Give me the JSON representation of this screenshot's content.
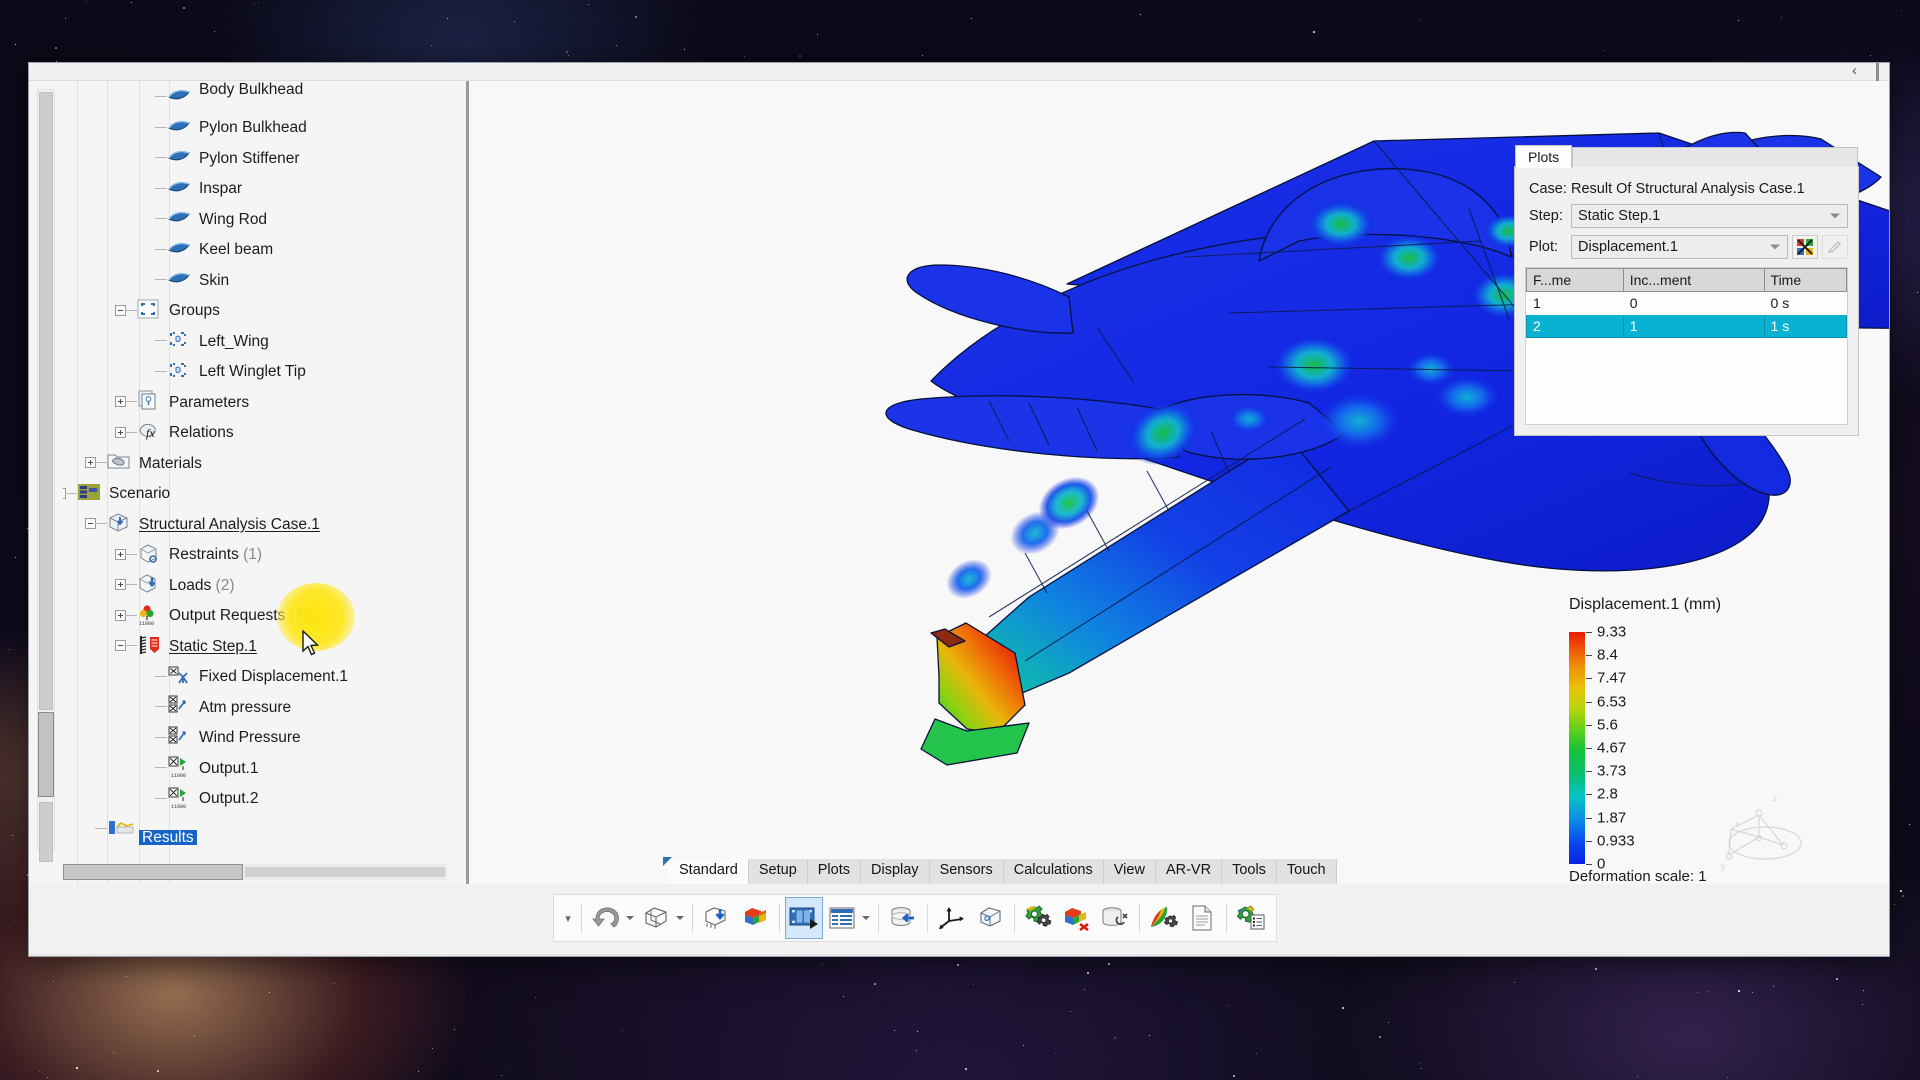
{
  "window": {
    "collapse_icon": "chevron-left-icon"
  },
  "tree": {
    "items": [
      {
        "label": "Body Bulkhead",
        "icon": "surface-icon",
        "depth": 4,
        "expander": "none",
        "partial_top": true
      },
      {
        "label": "Pylon Bulkhead",
        "icon": "surface-icon",
        "depth": 4,
        "expander": "none"
      },
      {
        "label": "Pylon Stiffener",
        "icon": "surface-icon",
        "depth": 4,
        "expander": "none"
      },
      {
        "label": "Inspar",
        "icon": "surface-icon",
        "depth": 4,
        "expander": "none"
      },
      {
        "label": "Wing Rod",
        "icon": "surface-icon",
        "depth": 4,
        "expander": "none"
      },
      {
        "label": "Keel beam",
        "icon": "surface-icon",
        "depth": 4,
        "expander": "none"
      },
      {
        "label": "Skin",
        "icon": "surface-icon",
        "depth": 4,
        "expander": "none",
        "last_child": true
      },
      {
        "label": "Groups",
        "icon": "groups-icon",
        "depth": 3,
        "expander": "minus"
      },
      {
        "label": "Left_Wing",
        "icon": "group-selection-icon",
        "depth": 4,
        "expander": "none"
      },
      {
        "label": "Left Winglet Tip",
        "icon": "group-selection-icon",
        "depth": 4,
        "expander": "none",
        "last_child": true
      },
      {
        "label": "Parameters",
        "icon": "parameters-icon",
        "depth": 3,
        "expander": "plus"
      },
      {
        "label": "Relations",
        "icon": "relations-fx-icon",
        "depth": 3,
        "expander": "plus"
      },
      {
        "label": "Materials",
        "icon": "materials-folder-icon",
        "depth": 2,
        "expander": "plus"
      },
      {
        "label": "Scenario",
        "icon": "scenario-icon",
        "depth": 1,
        "expander": "minus"
      },
      {
        "label": "Structural Analysis Case.1",
        "icon": "analysis-case-icon",
        "depth": 2,
        "expander": "minus",
        "underline": true
      },
      {
        "label": "Restraints",
        "suffix": " (1)",
        "icon": "restraints-icon",
        "depth": 3,
        "expander": "plus"
      },
      {
        "label": "Loads",
        "suffix": " (2)",
        "icon": "loads-icon",
        "depth": 3,
        "expander": "plus"
      },
      {
        "label": "Output Requests",
        "suffix": " (2)",
        "icon": "output-requests-icon",
        "depth": 3,
        "expander": "plus"
      },
      {
        "label": "Static Step.1",
        "icon": "static-step-icon",
        "depth": 3,
        "expander": "minus",
        "underline": true
      },
      {
        "label": "Fixed Displacement.1",
        "icon": "fixed-displacement-icon",
        "depth": 4,
        "expander": "none"
      },
      {
        "label": "Atm pressure",
        "icon": "pressure-icon",
        "depth": 4,
        "expander": "none"
      },
      {
        "label": "Wind Pressure",
        "icon": "pressure-icon",
        "depth": 4,
        "expander": "none"
      },
      {
        "label": "Output.1",
        "icon": "output-icon",
        "depth": 4,
        "expander": "none"
      },
      {
        "label": "Output.2",
        "icon": "output-icon",
        "depth": 4,
        "expander": "none",
        "last_child": true
      },
      {
        "label": "Results",
        "icon": "results-icon",
        "depth": 2,
        "expander": "none",
        "selected": true,
        "clipped": true
      }
    ]
  },
  "plots_panel": {
    "tab_label": "Plots",
    "case_label": "Case:",
    "case_value": "Result Of Structural Analysis Case.1",
    "step_label": "Step:",
    "step_value": "Static Step.1",
    "plot_label": "Plot:",
    "plot_value": "Displacement.1",
    "plot_settings_icon": "color-plot-settings-icon",
    "plot_edit_icon": "pencil-edit-icon",
    "table": {
      "columns": [
        "F...me",
        "Inc...ment",
        "Time"
      ],
      "rows": [
        {
          "cells": [
            "1",
            "0",
            "0 s"
          ],
          "selected": false
        },
        {
          "cells": [
            "2",
            "1",
            "1 s"
          ],
          "selected": true
        }
      ]
    }
  },
  "legend": {
    "title": "Displacement.1 (mm)",
    "ticks": [
      "9.33",
      "8.4",
      "7.47",
      "6.53",
      "5.6",
      "4.67",
      "3.73",
      "2.8",
      "1.87",
      "0.933",
      "0"
    ],
    "deformation_scale": "Deformation scale: 1",
    "compass_labels": [
      "X",
      "Y",
      "Z"
    ],
    "max_value": 9.33,
    "min_value": 0,
    "unit": "mm"
  },
  "bottom_tabs": [
    {
      "label": "Standard",
      "active": true
    },
    {
      "label": "Setup",
      "active": false
    },
    {
      "label": "Plots",
      "active": false
    },
    {
      "label": "Display",
      "active": false
    },
    {
      "label": "Sensors",
      "active": false
    },
    {
      "label": "Calculations",
      "active": false
    },
    {
      "label": "View",
      "active": false
    },
    {
      "label": "AR-VR",
      "active": false
    },
    {
      "label": "Tools",
      "active": false
    },
    {
      "label": "Touch",
      "active": false
    }
  ],
  "toolbar": {
    "overflow_icon": "chevron-down-icon",
    "buttons": [
      {
        "icon": "undo-icon",
        "dropdown": true,
        "selected": false
      },
      {
        "icon": "mesh-part-icon",
        "dropdown": true,
        "selected": false
      },
      {
        "icon": "import-mesh-icon",
        "dropdown": false,
        "selected": false
      },
      {
        "icon": "color-result-icon",
        "dropdown": false,
        "selected": false
      },
      {
        "icon": "animation-filmstrip-icon",
        "dropdown": false,
        "selected": true
      },
      {
        "icon": "report-table-icon",
        "dropdown": true,
        "selected": false
      },
      {
        "icon": "database-import-icon",
        "dropdown": false,
        "selected": false
      },
      {
        "icon": "axis-system-icon",
        "dropdown": false,
        "selected": false
      },
      {
        "icon": "extract-part-icon",
        "dropdown": false,
        "selected": false
      },
      {
        "icon": "compute-gears-icon",
        "dropdown": false,
        "selected": false
      },
      {
        "icon": "clear-results-icon",
        "dropdown": false,
        "selected": false
      },
      {
        "icon": "storage-settings-icon",
        "dropdown": false,
        "selected": false
      },
      {
        "icon": "feather-settings-icon",
        "dropdown": false,
        "selected": false
      },
      {
        "icon": "document-icon",
        "dropdown": false,
        "selected": false
      },
      {
        "icon": "gear-list-icon",
        "dropdown": false,
        "selected": false
      }
    ]
  },
  "viewport": {
    "model": "airplane-fem-displacement-result"
  }
}
